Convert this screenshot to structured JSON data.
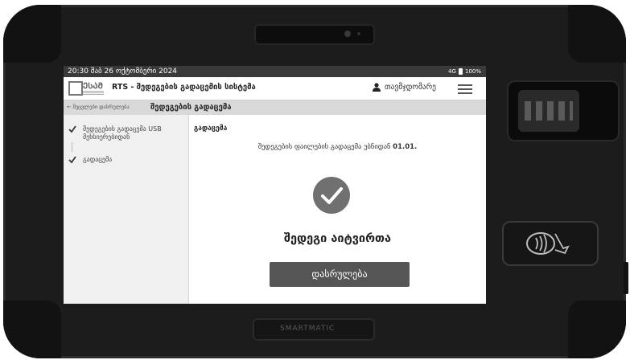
{
  "statusbar": {
    "time": "20:30 შაბ 26 ოქტომბერი 2024",
    "network": "4G",
    "battery": "100%"
  },
  "app": {
    "logo": "ᲔᲡᲐᲛ",
    "title": "RTS - შედეგების გადაცემის სისტემა",
    "user": "თავმჯდომარე"
  },
  "subbar": {
    "back": "← შეცვლები დასრულება",
    "page_title": "შედეგების გადაცემა"
  },
  "sidebar": {
    "steps": [
      {
        "label": "შედეგების გადაცემა USB მეხსიერებიდან"
      },
      {
        "label": "გადაცემა"
      }
    ]
  },
  "content": {
    "section_title": "გადაცემა",
    "message_prefix": "შედეგების ფაილების გადაცემა უბნიდან",
    "message_bold": "01.01.",
    "result": "შედეგი აიტვირთა",
    "finish_button": "დასრულება"
  },
  "device": {
    "brand": "SMARTMATIC"
  }
}
